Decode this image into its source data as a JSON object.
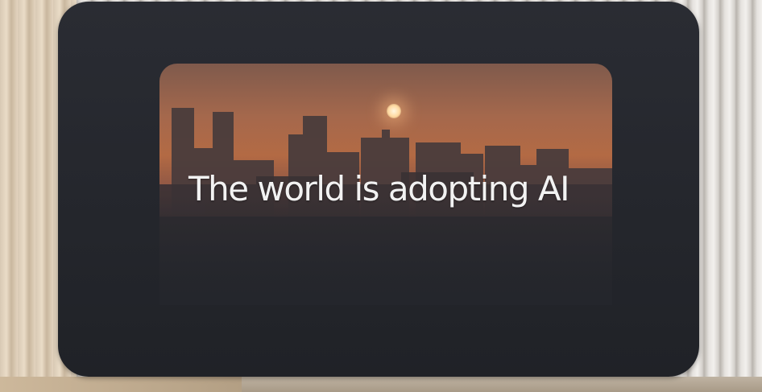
{
  "display": {
    "caption": "The world is adopting AI"
  },
  "colors": {
    "display_bezel": "#24262c",
    "sky_top": "#7f5a4c",
    "sky_glow": "#b36a44",
    "sun": "#fff6e0",
    "caption_text": "#f2f2f2",
    "wall_slats": "#e6e3df"
  }
}
